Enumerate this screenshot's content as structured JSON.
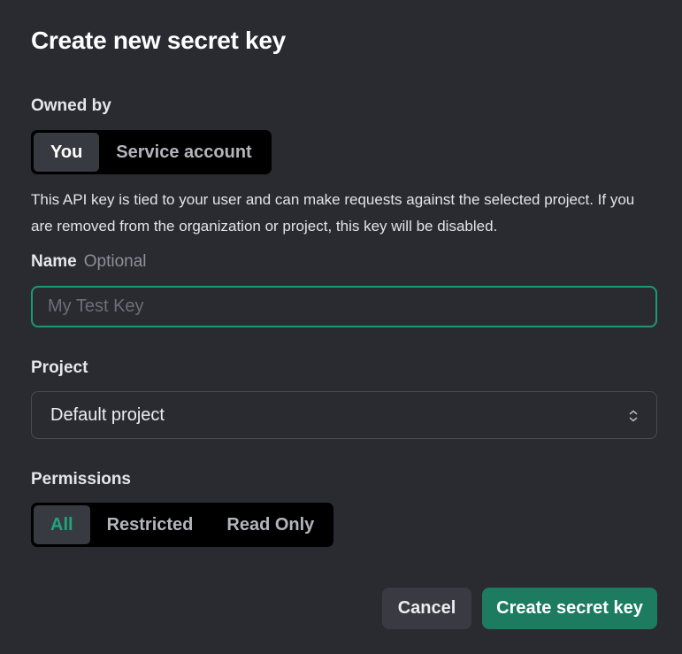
{
  "dialog": {
    "title": "Create new secret key"
  },
  "owned_by": {
    "label": "Owned by",
    "options": [
      "You",
      "Service account"
    ],
    "selected": "You",
    "description": "This API key is tied to your user and can make requests against the selected project. If you are removed from the organization or project, this key will be disabled."
  },
  "name": {
    "label": "Name",
    "optional_hint": "Optional",
    "value": "",
    "placeholder": "My Test Key"
  },
  "project": {
    "label": "Project",
    "selected": "Default project",
    "icon": "chevron-up-down-icon"
  },
  "permissions": {
    "label": "Permissions",
    "options": [
      "All",
      "Restricted",
      "Read Only"
    ],
    "selected": "All"
  },
  "actions": {
    "cancel_label": "Cancel",
    "create_label": "Create secret key"
  },
  "colors": {
    "accent": "#1fa57a",
    "primary_button": "#1d7b5f",
    "focus_border": "#1a9a72",
    "background": "#2a2b30"
  }
}
